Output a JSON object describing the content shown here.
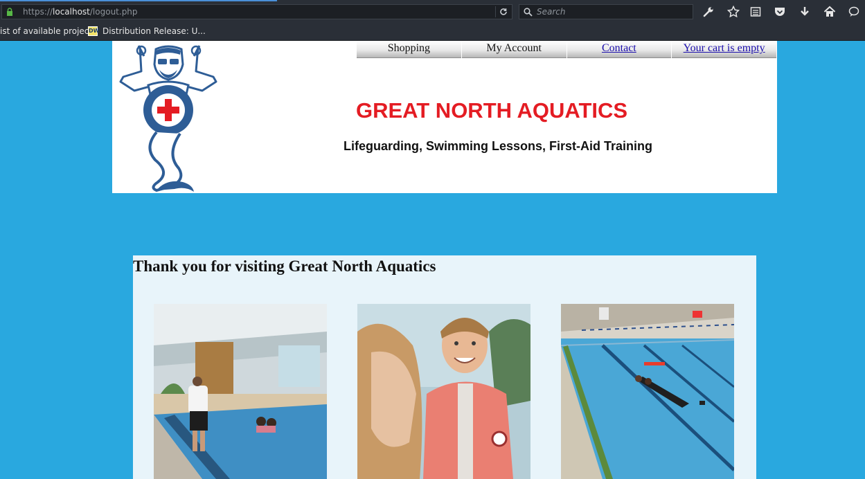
{
  "browser": {
    "url_prefix": "https://",
    "url_host": "localhost",
    "url_path": "/logout.php",
    "search_placeholder": "Search",
    "bookmarks": [
      {
        "label": "ist of available projec..."
      },
      {
        "label": "Distribution Release: U..."
      }
    ],
    "bookmark_icon_text": "DW"
  },
  "header": {
    "nav": [
      {
        "label": "Shopping",
        "link": false
      },
      {
        "label": "My Account",
        "link": false
      },
      {
        "label": "Contact",
        "link": true
      },
      {
        "label": "Your cart is empty",
        "link": true
      }
    ],
    "title": "GREAT NORTH AQUATICS",
    "subtitle": "Lifeguarding, Swimming Lessons, First-Aid Training",
    "logo_text": "GREAT NORTH AQUATICS"
  },
  "main": {
    "heading": "Thank you for visiting Great North Aquatics",
    "photos": [
      {
        "icon": "indoor-pool-photo"
      },
      {
        "icon": "child-life-jacket-photo"
      },
      {
        "icon": "lap-pool-rescue-photo"
      }
    ]
  },
  "colors": {
    "page_background": "#29a8df",
    "title_red": "#e41c23",
    "logo_blue": "#2e5d96",
    "content_background": "#e8f4fa"
  }
}
